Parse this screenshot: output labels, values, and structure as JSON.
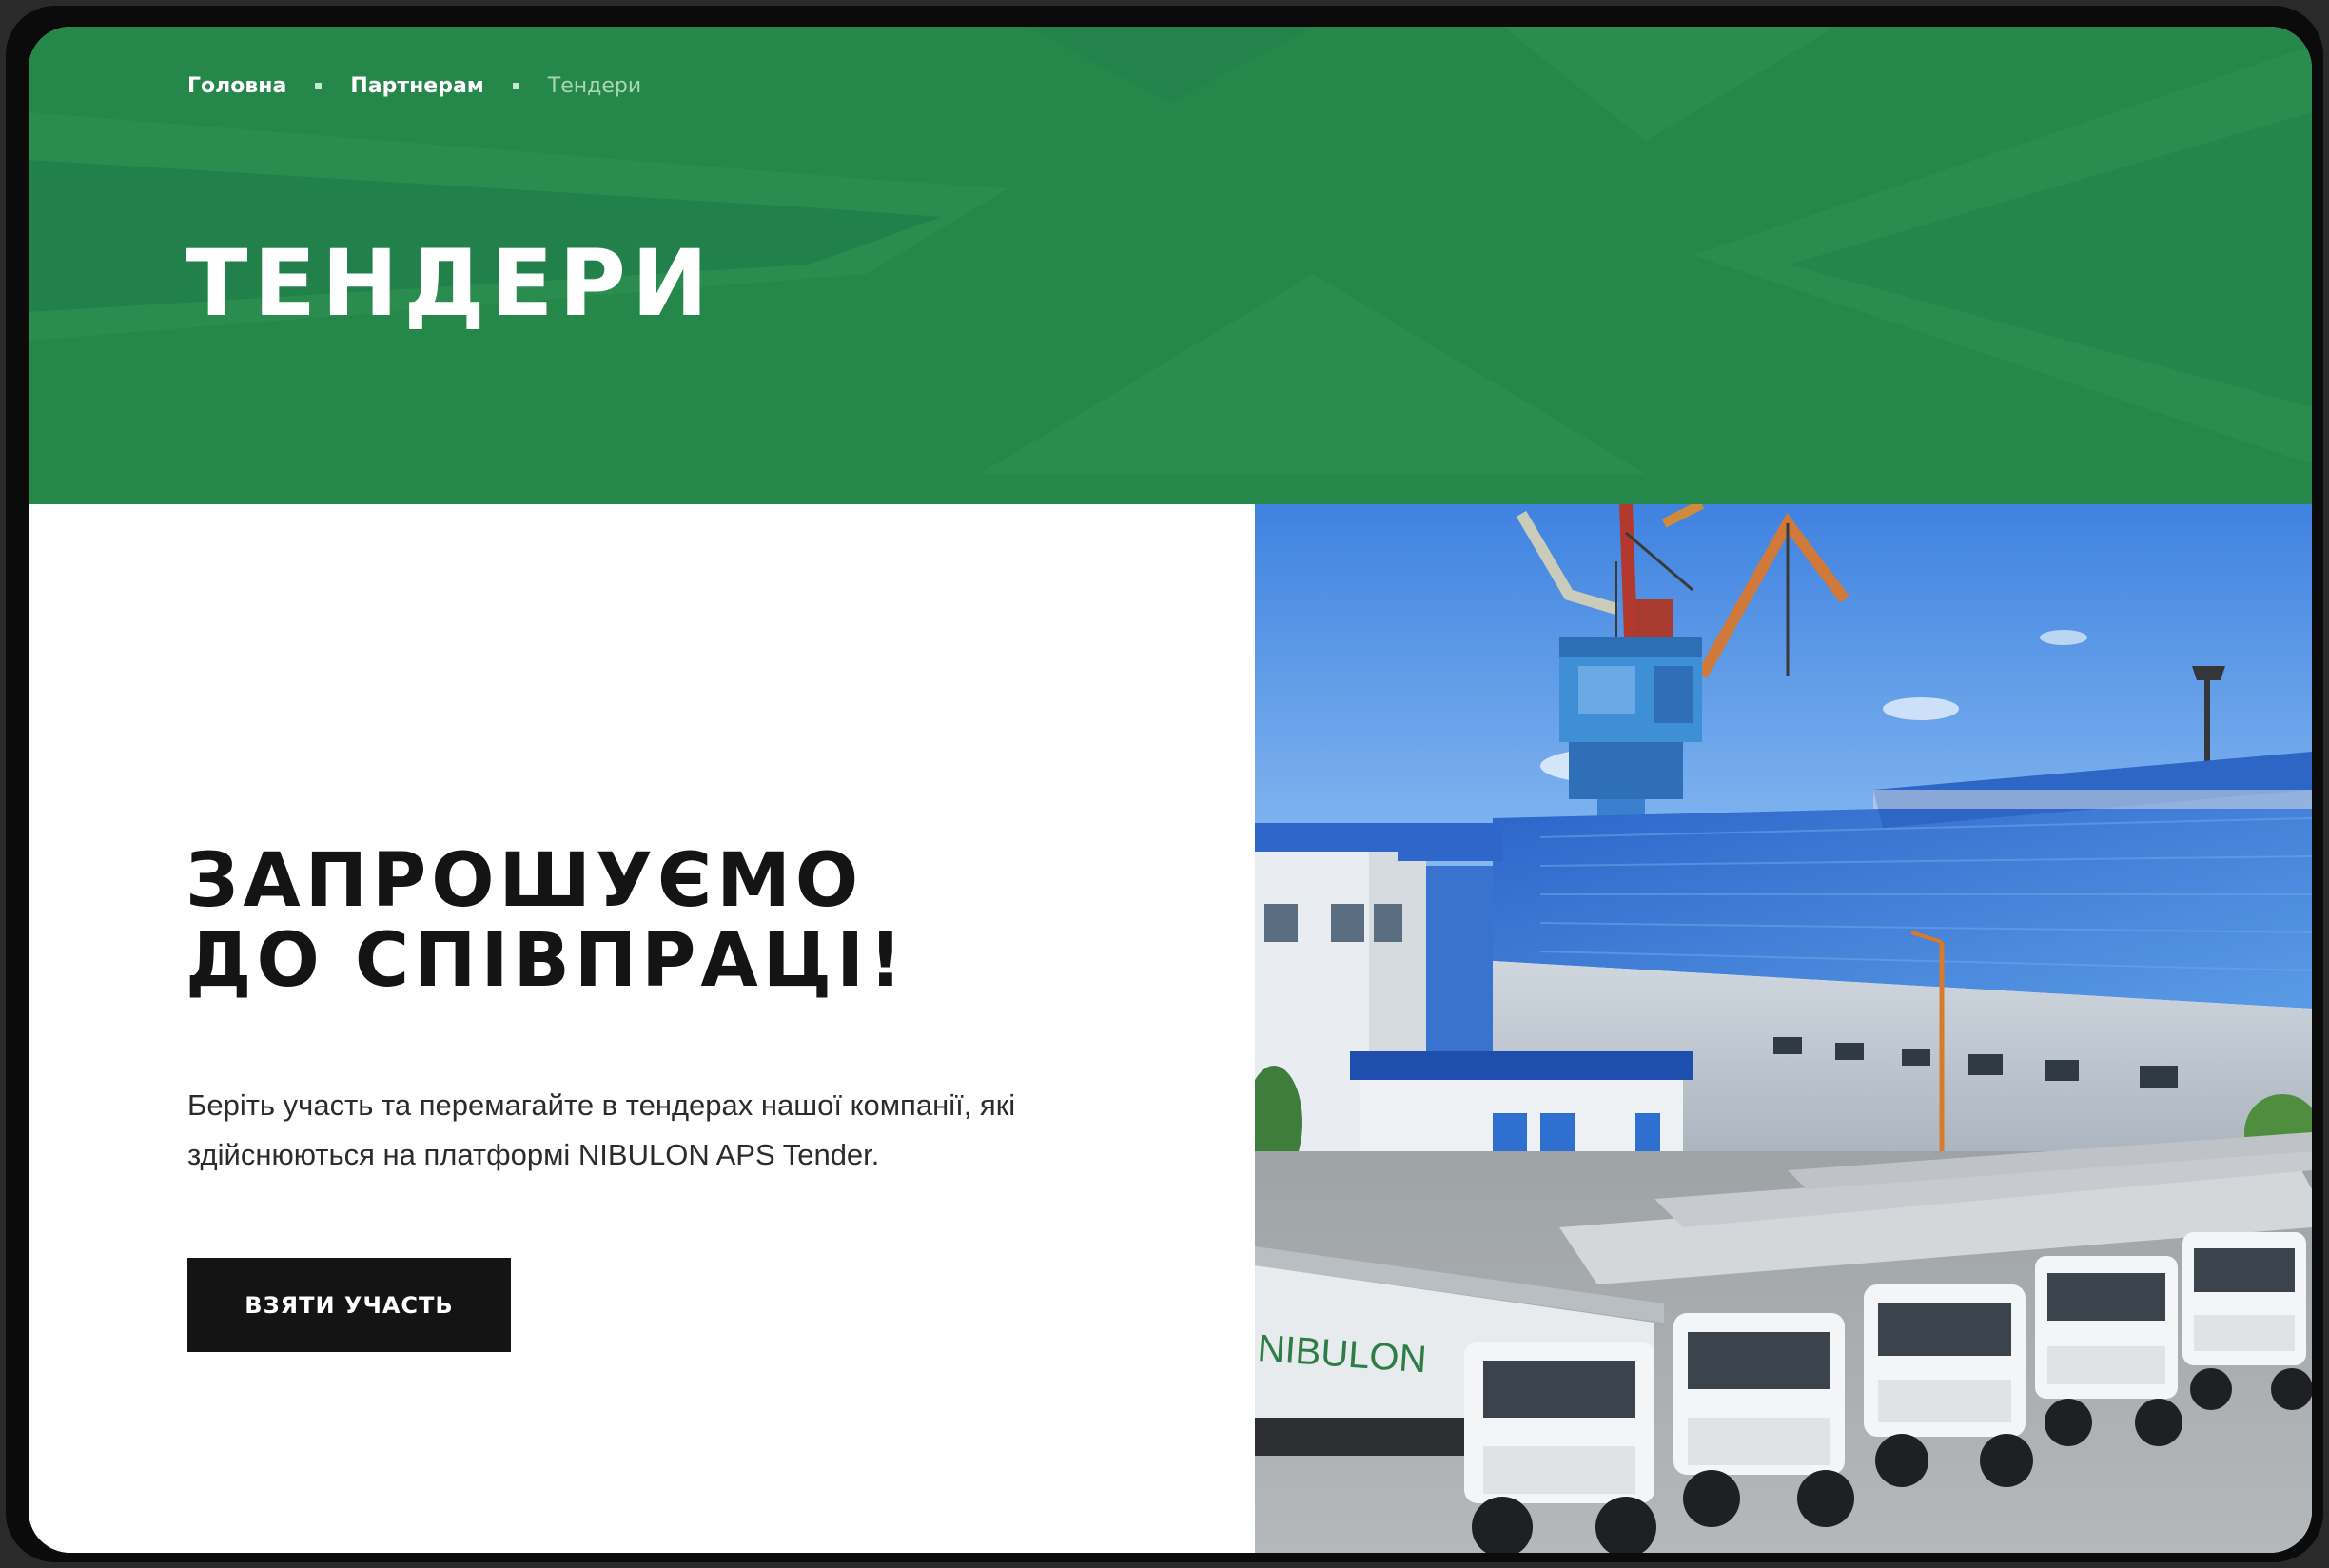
{
  "breadcrumb": {
    "items": [
      "Головна",
      "Партнерам",
      "Тендери"
    ]
  },
  "hero": {
    "title": "ТЕНДЕРИ",
    "background_color": "#25874a"
  },
  "invite": {
    "title_line1": "ЗАПРОШУЄМО",
    "title_line2": "ДО СПІВПРАЦІ!",
    "text": "Беріть участь та перемагайте в тендерах нашої компанії, які здійснюються на платформі NIBULON APS Tender.",
    "button_label": "ВЗЯТИ УЧАСТЬ"
  },
  "photo": {
    "truck_branding": "NIBULON"
  },
  "colors": {
    "accent_green": "#25874a",
    "button_black": "#141414",
    "roof_blue": "#2f6fd0"
  }
}
